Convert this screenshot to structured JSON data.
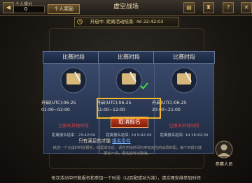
{
  "topbar": {
    "score_label": "个人得分",
    "score_value": "0",
    "personal_reward": "个人奖励",
    "title": "虚空战场"
  },
  "status": {
    "text": "开启中, 距离活动结束: 4d 22:42:03"
  },
  "cards": [
    {
      "head": "比赛时段",
      "time": "开启(UTC):06-25 01:00~02:00",
      "status": "已报名其他时段",
      "distance": "距离报名结束：23:42:04",
      "state": "other"
    },
    {
      "head": "比赛时段",
      "time": "开启(UTC):06-25 11:00~12:00",
      "button": "取消报名",
      "distance": "距离报名结束: 1d 9:42:04",
      "state": "registered"
    },
    {
      "head": "比赛时段",
      "time": "开启(UTC):06-25 20:00~21:00",
      "status": "已报名其他时段",
      "distance": "距离报名结束: 1d 18:42:04",
      "state": "other"
    }
  ],
  "info": {
    "prefix": "只有满足",
    "mid": "的才能",
    "link": "报名条件",
    "description": "挑选一个合适的时段报名。匹配成功后，请在开始时间内参加对应的战场匹配。每个时段只能报名一次，报名后可以取消。"
  },
  "participants": {
    "label": "参赛人员"
  },
  "bottom_note": "每次活动中只能报名和参加一个时段（以匹配成功为准），请合理安排参加时间",
  "colors": {
    "highlight": "#f2b72a",
    "cancel_button": "#c8401e",
    "status_red": "#d84040",
    "card_blue": "#2a3854"
  }
}
